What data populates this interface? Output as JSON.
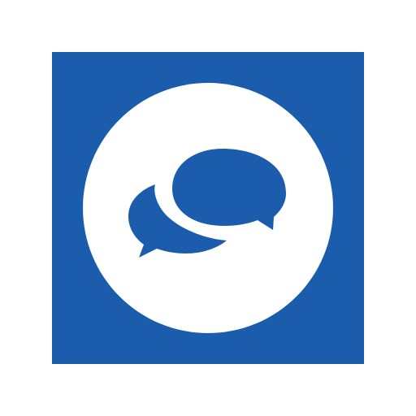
{
  "app_icon": {
    "icon_name": "chat-bubbles-icon",
    "background_color": "#1b5dac",
    "circle_color": "#ffffff",
    "glyph_color": "#1b5dac"
  }
}
